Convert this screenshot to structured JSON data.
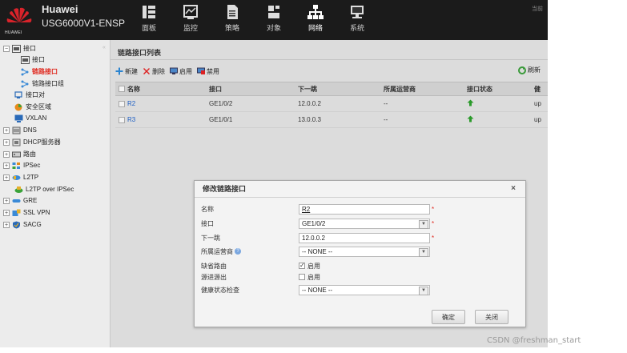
{
  "header": {
    "brand": "Huawei",
    "model": "USG6000V1-ENSP",
    "logo_text": "HUAWEI",
    "user_text": "当前",
    "nav": [
      {
        "label": "面板",
        "icon": "dashboard-icon"
      },
      {
        "label": "监控",
        "icon": "monitor-icon"
      },
      {
        "label": "策略",
        "icon": "policy-icon"
      },
      {
        "label": "对象",
        "icon": "object-icon"
      },
      {
        "label": "网络",
        "icon": "network-icon",
        "active": true
      },
      {
        "label": "系统",
        "icon": "system-icon"
      }
    ]
  },
  "sidebar": {
    "items": [
      {
        "label": "接口",
        "icon": "interface-icon",
        "expander": "−"
      },
      {
        "label": "接口",
        "icon": "interface-icon"
      },
      {
        "label": "链路接口",
        "icon": "link-interface-icon",
        "selected": true
      },
      {
        "label": "链路接口组",
        "icon": "link-group-icon"
      },
      {
        "label": "接口对",
        "icon": "interface-pair-icon"
      },
      {
        "label": "安全区域",
        "icon": "security-zone-icon"
      },
      {
        "label": "VXLAN",
        "icon": "vxlan-icon"
      },
      {
        "label": "DNS",
        "icon": "dns-icon",
        "expander": "+"
      },
      {
        "label": "DHCP服务器",
        "icon": "dhcp-icon",
        "expander": "+"
      },
      {
        "label": "路由",
        "icon": "route-icon",
        "expander": "+"
      },
      {
        "label": "IPSec",
        "icon": "ipsec-icon",
        "expander": "+"
      },
      {
        "label": "L2TP",
        "icon": "l2tp-icon",
        "expander": "+"
      },
      {
        "label": "L2TP over IPSec",
        "icon": "l2tp-ipsec-icon"
      },
      {
        "label": "GRE",
        "icon": "gre-icon",
        "expander": "+"
      },
      {
        "label": "SSL VPN",
        "icon": "sslvpn-icon",
        "expander": "+"
      },
      {
        "label": "SACG",
        "icon": "sacg-icon",
        "expander": "+"
      }
    ]
  },
  "main": {
    "title": "链路接口列表",
    "toolbar": {
      "new": "新建",
      "delete": "删除",
      "enable": "启用",
      "disable": "禁用",
      "refresh": "刷新"
    },
    "columns": [
      "名称",
      "接口",
      "下一跳",
      "所属运营商",
      "接口状态",
      "健"
    ],
    "rows": [
      {
        "name": "R2",
        "interface": "GE1/0/2",
        "next_hop": "12.0.0.2",
        "isp": "--",
        "health": "up"
      },
      {
        "name": "R3",
        "interface": "GE1/0/1",
        "next_hop": "13.0.0.3",
        "isp": "--",
        "health": "up"
      }
    ]
  },
  "dialog": {
    "title": "修改链路接口",
    "close": "×",
    "fields": {
      "name_label": "名称",
      "name_value": "R2",
      "interface_label": "接口",
      "interface_value": "GE1/0/2",
      "next_hop_label": "下一跳",
      "next_hop_value": "12.0.0.2",
      "isp_label": "所属运营商",
      "isp_value": "-- NONE --",
      "default_route_label": "缺省路由",
      "default_route_check": "启用",
      "source_in_out_label": "源进源出",
      "source_in_out_check": "启用",
      "health_label": "健康状态检查",
      "health_value": "-- NONE --"
    },
    "ok": "确定",
    "cancel": "关闭"
  },
  "watermark": "CSDN @freshman_start",
  "colors": {
    "accent_red": "#e0281e",
    "link_blue": "#1d5fc5",
    "header_bg": "#1b1b1b",
    "status_up": "#2a9a2a"
  }
}
